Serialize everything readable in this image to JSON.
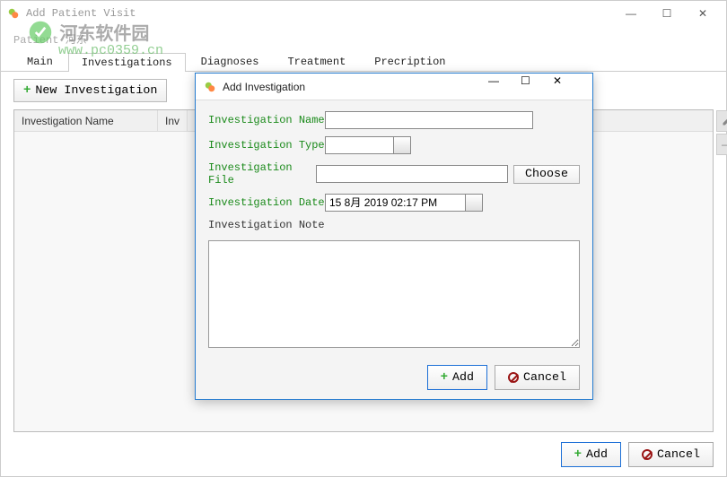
{
  "window": {
    "title": "Add Patient Visit"
  },
  "watermark": {
    "text": "河东软件园",
    "url": "www.pc0359.cn"
  },
  "patient": {
    "label": "Patient",
    "name": "河东"
  },
  "tabs": [
    {
      "label": "Main"
    },
    {
      "label": "Investigations"
    },
    {
      "label": "Diagnoses"
    },
    {
      "label": "Treatment"
    },
    {
      "label": "Precription"
    }
  ],
  "toolbar": {
    "new_investigation": "New Investigation"
  },
  "table": {
    "columns": [
      "Investigation Name",
      "Inv"
    ]
  },
  "footer": {
    "add": "Add",
    "cancel": "Cancel"
  },
  "modal": {
    "title": "Add Investigation",
    "labels": {
      "name": "Investigation Name",
      "type": "Investigation Type",
      "file": "Investigation File",
      "date": "Investigation Date",
      "note": "Investigation Note"
    },
    "values": {
      "name": "",
      "type": "",
      "file": "",
      "date": "15 8月 2019 02:17 PM",
      "note": ""
    },
    "choose": "Choose",
    "add": "Add",
    "cancel": "Cancel"
  }
}
